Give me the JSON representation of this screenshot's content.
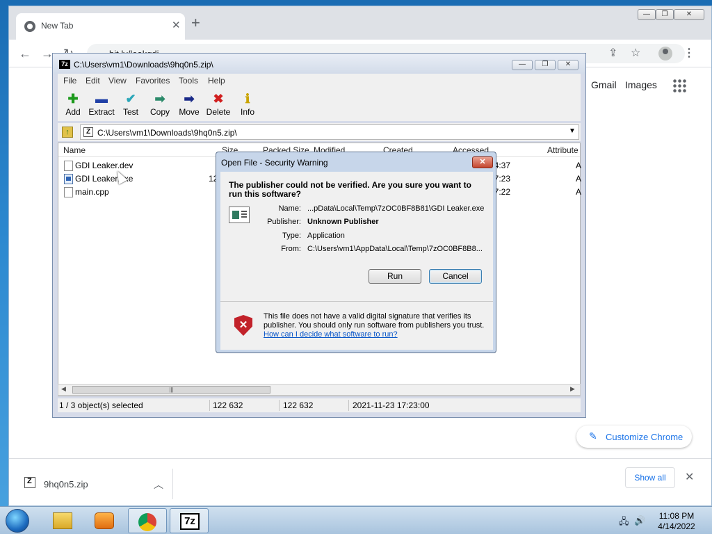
{
  "chrome": {
    "tab_title": "New Tab",
    "url": "bit.ly/leakgdi",
    "ntp_links": [
      "Gmail",
      "Images"
    ],
    "customize_label": "Customize Chrome",
    "download": {
      "filename": "9hq0n5.zip",
      "show_all": "Show all"
    }
  },
  "zip": {
    "title": "C:\\Users\\vm1\\Downloads\\9hq0n5.zip\\",
    "menu": [
      "File",
      "Edit",
      "View",
      "Favorites",
      "Tools",
      "Help"
    ],
    "toolbar": [
      {
        "label": "Add",
        "icon": "plus-icon",
        "color": "#1d9a1d"
      },
      {
        "label": "Extract",
        "icon": "minus-icon",
        "color": "#1f3fa6"
      },
      {
        "label": "Test",
        "icon": "check-icon",
        "color": "#2aa6b8"
      },
      {
        "label": "Copy",
        "icon": "copy-arrow-icon",
        "color": "#2b8a6a"
      },
      {
        "label": "Move",
        "icon": "move-arrow-icon",
        "color": "#1a2a88"
      },
      {
        "label": "Delete",
        "icon": "delete-x-icon",
        "color": "#d11f1f"
      },
      {
        "label": "Info",
        "icon": "info-icon",
        "color": "#c9a400"
      }
    ],
    "address": "C:\\Users\\vm1\\Downloads\\9hq0n5.zip\\",
    "columns": [
      "Name",
      "Size",
      "Packed Size",
      "Modified",
      "Created",
      "Accessed",
      "Attribute"
    ],
    "files": [
      {
        "name": "GDI Leaker.dev",
        "size": "",
        "accessed": "04:37",
        "attr": "A"
      },
      {
        "name": "GDI Leaker.exe",
        "size": "12",
        "accessed": "17:23",
        "attr": "A"
      },
      {
        "name": "main.cpp",
        "size": "",
        "accessed": "17:22",
        "attr": "A"
      }
    ],
    "status": {
      "selected": "1 / 3 object(s) selected",
      "size": "122 632",
      "packed": "122 632",
      "modified": "2021-11-23 17:23:00"
    }
  },
  "dialog": {
    "title": "Open File - Security Warning",
    "heading": "The publisher could not be verified.  Are you sure you want to run this software?",
    "fields": [
      {
        "label": "Name:",
        "value": "...pData\\Local\\Temp\\7zOC0BF8B81\\GDI Leaker.exe",
        "bold": false
      },
      {
        "label": "Publisher:",
        "value": "Unknown Publisher",
        "bold": true
      },
      {
        "label": "Type:",
        "value": "Application",
        "bold": false
      },
      {
        "label": "From:",
        "value": "C:\\Users\\vm1\\AppData\\Local\\Temp\\7zOC0BF8B8...",
        "bold": false
      }
    ],
    "run_label": "Run",
    "cancel_label": "Cancel",
    "footer_text": "This file does not have a valid digital signature that verifies its publisher.  You should only run software from publishers you trust.",
    "help_link": "How can I decide what software to run?"
  },
  "taskbar": {
    "time": "11:08 PM",
    "date": "4/14/2022"
  }
}
